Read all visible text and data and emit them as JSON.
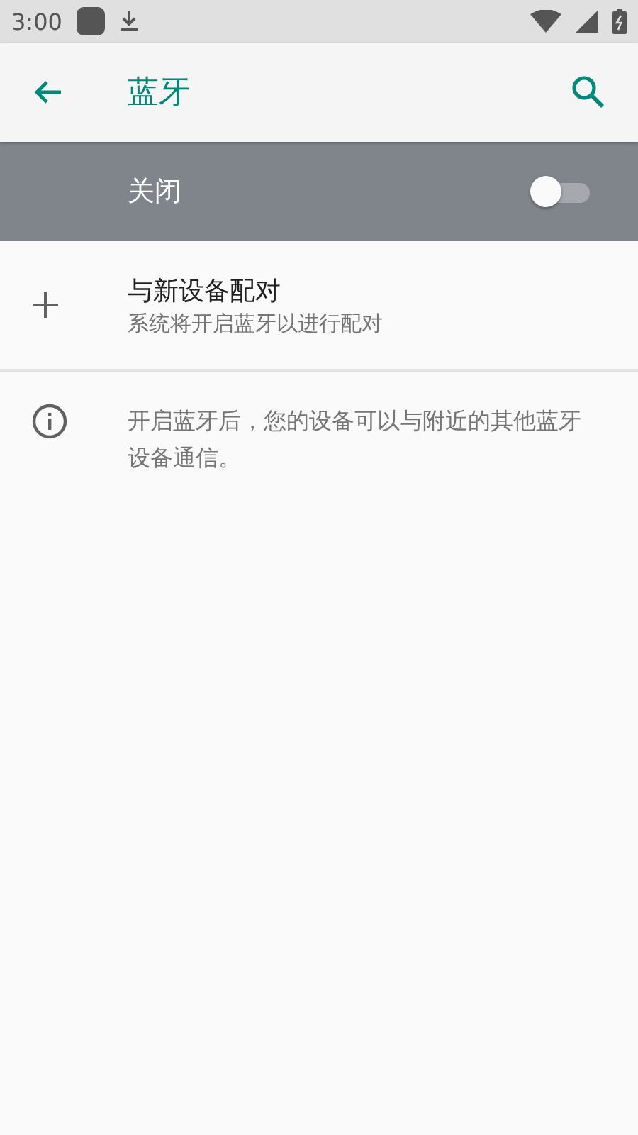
{
  "status_bar": {
    "time": "3:00"
  },
  "app_bar": {
    "title": "蓝牙"
  },
  "master_switch": {
    "label": "关闭",
    "on": false
  },
  "items": [
    {
      "title": "与新设备配对",
      "summary": "系统将开启蓝牙以进行配对"
    }
  ],
  "footer": {
    "text": "开启蓝牙后，您的设备可以与附近的其他蓝牙设备通信。"
  }
}
